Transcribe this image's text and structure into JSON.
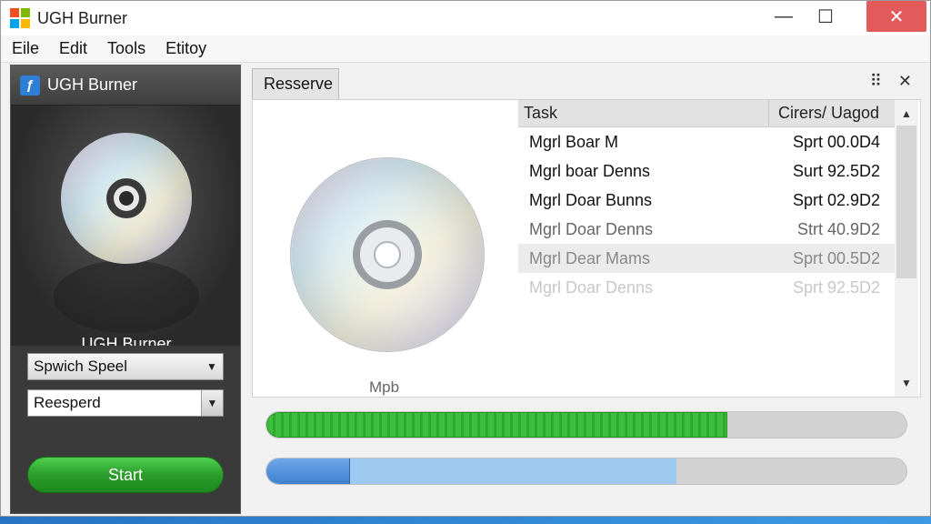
{
  "window": {
    "title": "UGH Burner",
    "minimize": "—",
    "maximize": "☐",
    "close": "✕"
  },
  "menu": [
    "Eile",
    "Edit",
    "Tools",
    "Etitoy"
  ],
  "left_panel": {
    "header": "UGH Burner",
    "name": "UGH Burner",
    "speed_select": "Spwich Speel",
    "mode_select": "Reesperd",
    "start_label": "Start"
  },
  "right_panel": {
    "tab": "Resserve",
    "disc_label": "Mpb",
    "table": {
      "headers": {
        "task": "Task",
        "speed": "Cirers/ Uagod"
      },
      "rows": [
        {
          "task": "Mgrl Boar M",
          "speed": "Sprt 00.0D4"
        },
        {
          "task": "Mgrl boar Denns",
          "speed": "Surt 92.5D2"
        },
        {
          "task": "Mgrl Doar Bunns",
          "speed": "Sprt 02.9D2"
        },
        {
          "task": "Mgrl Doar Denns",
          "speed": "Strt 40.9D2"
        },
        {
          "task": "Mgrl Dear Mams",
          "speed": "Sprt 00.5D2"
        },
        {
          "task": "Mgrl Doar Denns",
          "speed": "Sprt 92.5D2"
        }
      ]
    }
  },
  "progress": {
    "burn_fraction": 0.72,
    "second_fraction": 0.13,
    "second_buffer_fraction": 0.64
  },
  "colors": {
    "progress_green": "#3cbf3c",
    "progress_blue": "#4f8fd8",
    "start_green": "#2fa82f",
    "close_red": "#e35a5a"
  }
}
